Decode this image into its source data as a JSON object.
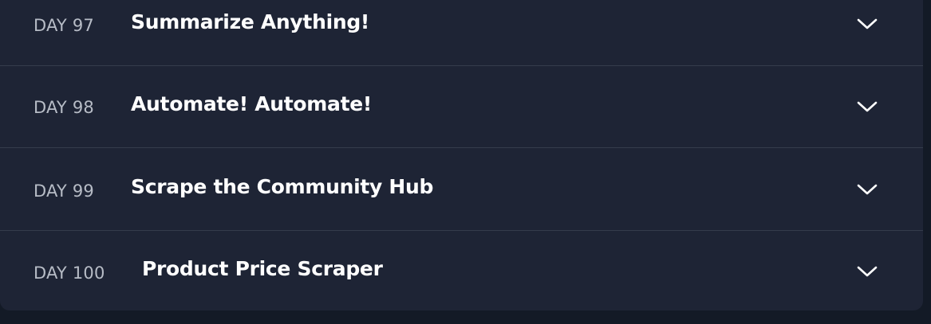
{
  "lessons": [
    {
      "day": "DAY 97",
      "title": "Summarize Anything!",
      "icon": "chevron-down-icon"
    },
    {
      "day": "DAY 98",
      "title": "Automate! Automate!",
      "icon": "chevron-down-icon"
    },
    {
      "day": "DAY 99",
      "title": "Scrape the Community Hub",
      "icon": "chevron-down-icon"
    },
    {
      "day": "DAY 100",
      "title": "Product Price Scraper",
      "icon": "chevron-down-icon"
    }
  ]
}
